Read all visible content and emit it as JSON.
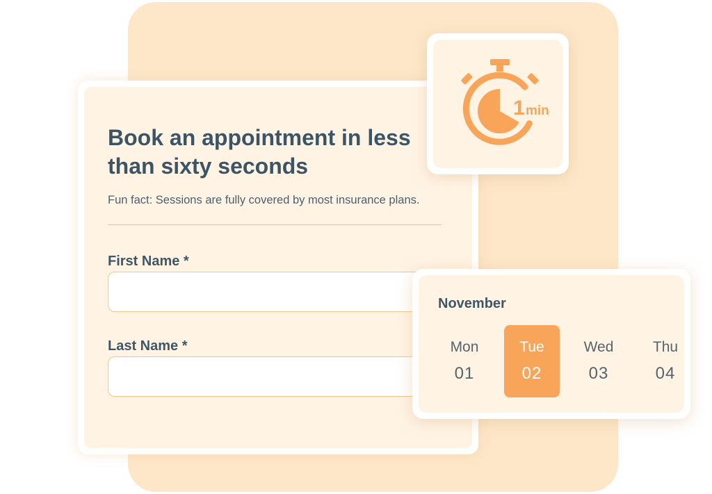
{
  "form": {
    "title": "Book an appointment in less than sixty seconds",
    "subtitle": "Fun fact: Sessions are fully covered by most insurance plans.",
    "first_name_label": "First Name *",
    "first_name_value": "",
    "last_name_label": "Last Name *",
    "last_name_value": ""
  },
  "timer": {
    "icon": "stopwatch-icon",
    "value": "1",
    "unit": "min"
  },
  "calendar": {
    "month": "November",
    "days": [
      {
        "weekday": "Mon",
        "date": "01",
        "selected": false
      },
      {
        "weekday": "Tue",
        "date": "02",
        "selected": true
      },
      {
        "weekday": "Wed",
        "date": "03",
        "selected": false
      },
      {
        "weekday": "Thu",
        "date": "04",
        "selected": false
      }
    ]
  },
  "colors": {
    "accent": "#f8a55a",
    "panel_background": "#fde7c8",
    "card_background": "#fff3e3",
    "heading_text": "#3b5566",
    "field_border": "#f1c58b"
  }
}
